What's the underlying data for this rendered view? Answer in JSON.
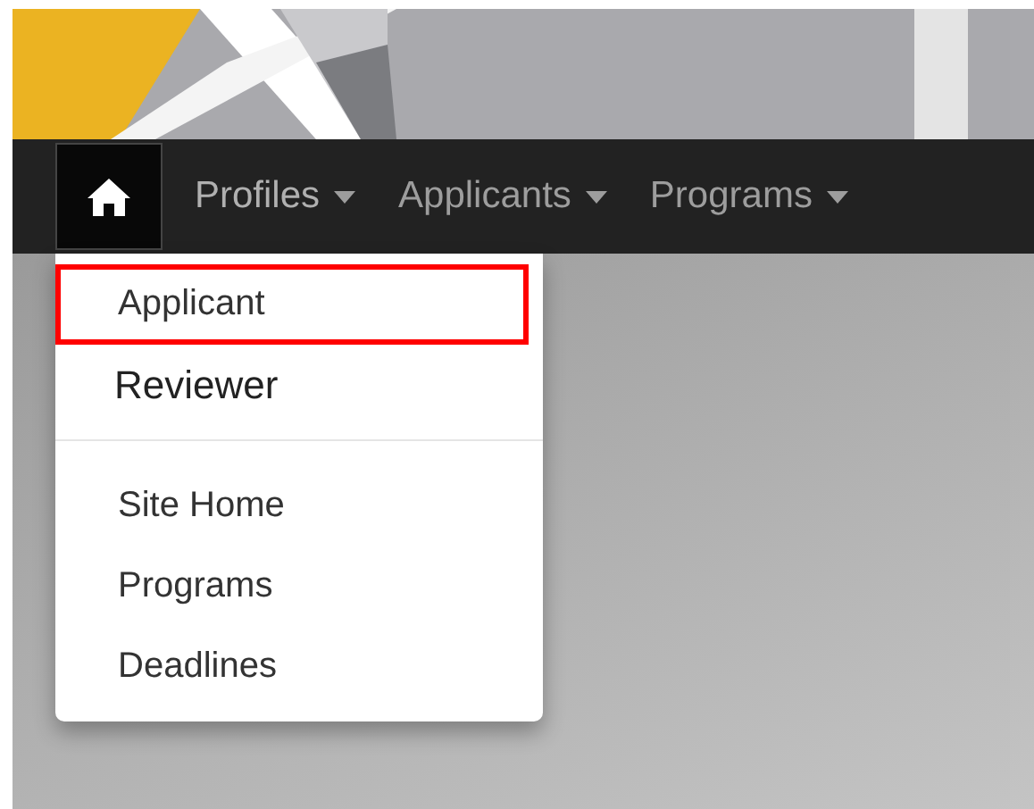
{
  "navbar": {
    "home_selected": true,
    "menus": [
      {
        "label": "Profiles",
        "expanded": true
      },
      {
        "label": "Applicants",
        "expanded": false
      },
      {
        "label": "Programs",
        "expanded": false
      }
    ]
  },
  "dropdown": {
    "sections": [
      [
        {
          "label": "Applicant",
          "kind": "link",
          "highlighted": true
        },
        {
          "label": "Reviewer",
          "kind": "current",
          "highlighted": false
        }
      ],
      [
        {
          "label": "Site Home",
          "kind": "link",
          "highlighted": false
        },
        {
          "label": "Programs",
          "kind": "link",
          "highlighted": false
        },
        {
          "label": "Deadlines",
          "kind": "link",
          "highlighted": false
        }
      ]
    ]
  }
}
